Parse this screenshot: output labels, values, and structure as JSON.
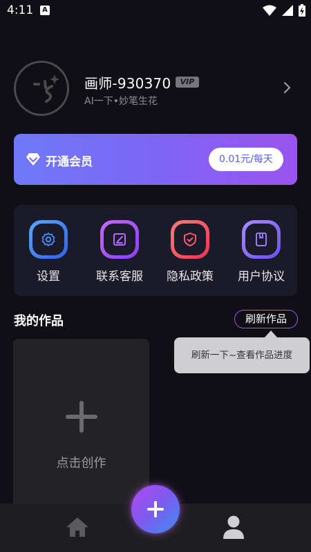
{
  "status_bar": {
    "time": "4:11",
    "notification_icon": "a-icon",
    "icons": [
      "wifi-icon",
      "signal-icon",
      "battery-charging-icon"
    ]
  },
  "profile": {
    "username": "画师-930370",
    "vip_badge": "VIP",
    "subtitle": "AI一下•妙笔生花",
    "avatar_icon": "winking-face-icon"
  },
  "vip_banner": {
    "title": "开通会员",
    "price_button": "0.01元/每天",
    "icon": "diamond-icon"
  },
  "menu": {
    "items": [
      {
        "label": "设置",
        "icon": "gear-icon",
        "color": "#3b82f6"
      },
      {
        "label": "联系客服",
        "icon": "edit-icon",
        "color": "#a855f7"
      },
      {
        "label": "隐私政策",
        "icon": "shield-icon",
        "color": "#ef4444"
      },
      {
        "label": "用户协议",
        "icon": "bookmark-icon",
        "color": "#8b5cf6"
      }
    ]
  },
  "works": {
    "title": "我的作品",
    "refresh_button": "刷新作品",
    "tooltip": "刷新一下~查看作品进度",
    "create_card_label": "点击创作"
  },
  "bottom_nav": {
    "items": [
      "home-icon",
      "add-icon",
      "user-icon"
    ]
  },
  "colors": {
    "background": "#0f0f15",
    "accent_purple": "#8064f4",
    "accent_blue": "#3d8df0"
  }
}
